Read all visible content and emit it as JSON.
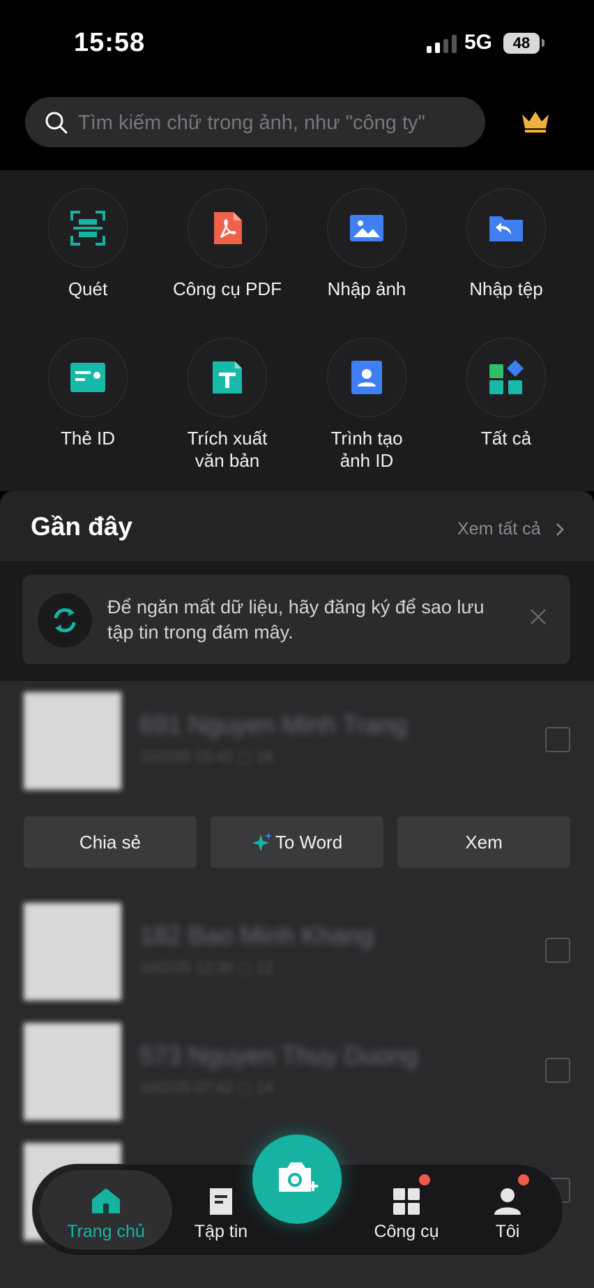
{
  "status_bar": {
    "time": "15:58",
    "network": "5G",
    "battery": "48"
  },
  "search": {
    "placeholder": "Tìm kiếm chữ trong ảnh, như \"công ty\""
  },
  "tools": [
    {
      "label": "Quét",
      "icon": "scan-icon"
    },
    {
      "label": "Công cụ PDF",
      "icon": "pdf-icon"
    },
    {
      "label": "Nhập ảnh",
      "icon": "image-icon"
    },
    {
      "label": "Nhập tệp",
      "icon": "folder-import-icon"
    },
    {
      "label": "Thẻ ID",
      "icon": "id-card-icon"
    },
    {
      "label": "Trích xuất\nvăn bản",
      "icon": "text-extract-icon"
    },
    {
      "label": "Trình tạo\nảnh ID",
      "icon": "id-photo-icon"
    },
    {
      "label": "Tất cả",
      "icon": "all-apps-icon"
    }
  ],
  "recent": {
    "title": "Gần đây",
    "see_all": "Xem tất cả",
    "notice": "Để ngăn mất dữ liệu, hãy đăng ký để sao lưu tập tin trong đám mây.",
    "actions": {
      "share": "Chia sẻ",
      "to_word": "To Word",
      "view": "Xem"
    },
    "files": [
      {
        "name": "691 Nguyen Minh Trang",
        "meta": "10/2/25 15:42   ▢ 16"
      },
      {
        "name": "182 Bao Minh Khang",
        "meta": "10/2/25 12:30   ▢ 12"
      },
      {
        "name": "573 Nguyen Thuy Duong",
        "meta": "10/2/25 07:42   ▢ 14"
      }
    ]
  },
  "nav": {
    "home": "Trang chủ",
    "files": "Tập tin",
    "tools": "Công cụ",
    "me": "Tôi"
  },
  "colors": {
    "accent": "#16b3a3",
    "badge": "#f05a4a",
    "crown": "#f0b040"
  }
}
